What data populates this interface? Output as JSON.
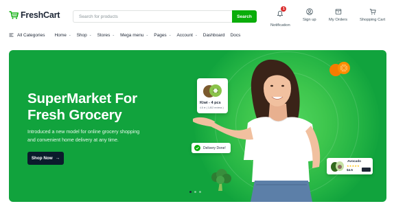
{
  "brand": {
    "name": "FreshCart",
    "accent": "#0aad0a",
    "hero_bg": "#11a33d"
  },
  "search": {
    "placeholder": "Search for products",
    "button_label": "Search",
    "value": ""
  },
  "header_actions": [
    {
      "label": "Notification",
      "icon": "bell-icon",
      "badge": "1"
    },
    {
      "label": "Sign up",
      "icon": "user-icon"
    },
    {
      "label": "My Orders",
      "icon": "orders-box-icon"
    },
    {
      "label": "Shopping Cart",
      "icon": "cart-icon"
    }
  ],
  "nav": {
    "categories_label": "All Categories",
    "items": [
      {
        "label": "Home",
        "dropdown": true
      },
      {
        "label": "Shop",
        "dropdown": true
      },
      {
        "label": "Stores",
        "dropdown": true
      },
      {
        "label": "Mega menu",
        "dropdown": true
      },
      {
        "label": "Pages",
        "dropdown": true
      },
      {
        "label": "Account",
        "dropdown": true
      },
      {
        "label": "Dashboard",
        "dropdown": false
      },
      {
        "label": "Docs",
        "dropdown": false
      }
    ]
  },
  "hero": {
    "title_line1": "SuperMarket For",
    "title_line2": "Fresh Grocery",
    "subtitle_line1": "Introduced a new model for online grocery shopping",
    "subtitle_line2": "and convenient home delivery at any time.",
    "cta_label": "Shop Now",
    "cta_arrow": "→",
    "kiwi_card": {
      "title": "Kiwi - 4 pcs",
      "rating_text": "4.8 ★ ( 1,802 reviews )"
    },
    "delivery_badge": "Delivery Done!",
    "avocado_card": {
      "name": "Avocado",
      "stars": "★★★★★",
      "price": "$4.5"
    },
    "slides": {
      "count": 3,
      "active_index": 0
    }
  }
}
